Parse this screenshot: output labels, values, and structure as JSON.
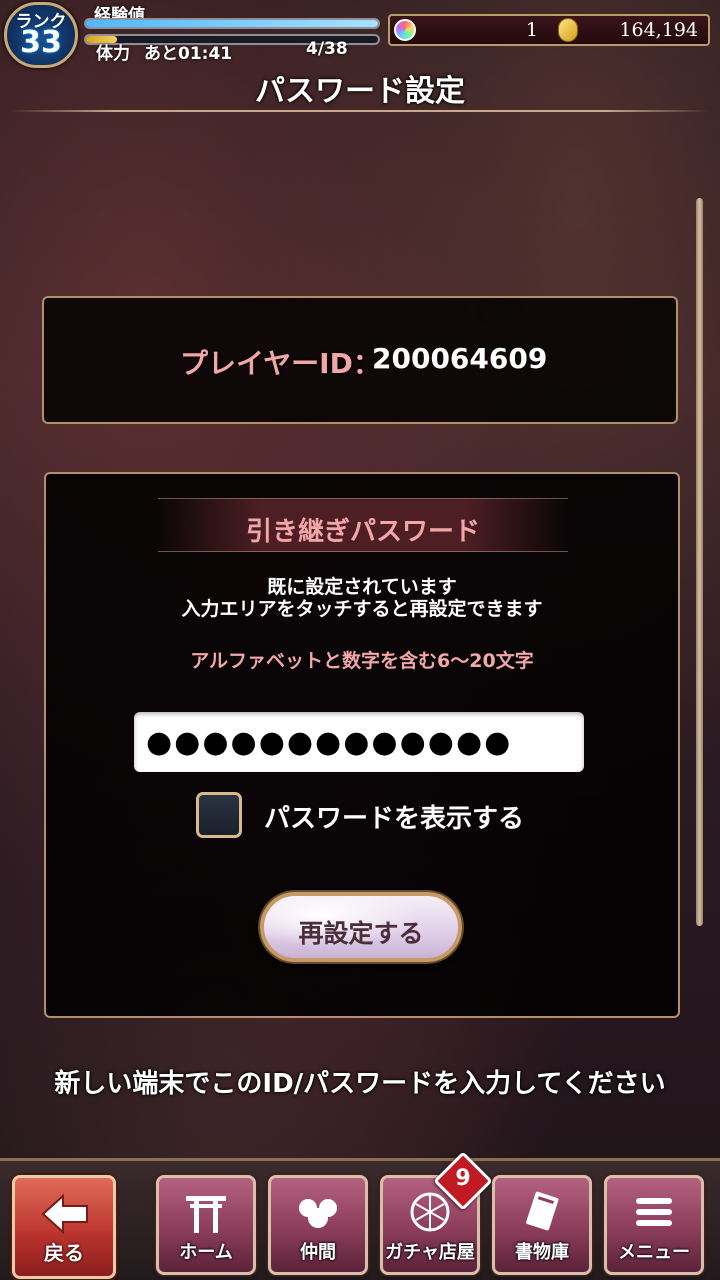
{
  "status": {
    "rank_label": "ランク",
    "rank_value": "33",
    "exp_label": "経験値",
    "exp_progress": 1.0,
    "stamina_label": "体力",
    "stamina_time": "あと01:41",
    "stamina_count": "4/38",
    "stamina_progress": 0.105,
    "gem_count": "1",
    "coin_count": "164,194"
  },
  "page": {
    "title": "パスワード設定"
  },
  "player": {
    "id_label": "プレイヤーID：",
    "id_value": "200064609"
  },
  "password_section": {
    "title": "引き継ぎパスワード",
    "status_line1": "既に設定されています",
    "status_line2": "入力エリアをタッチすると再設定できます",
    "rule": "アルファベットと数字を含む6〜20文字",
    "password_value": "●●●●●●●●●●●●●",
    "show_password_label": "パスワードを表示する",
    "show_password_checked": false,
    "reset_button": "再設定する"
  },
  "note": "新しい端末でこのID/パスワードを入力してください",
  "nav": {
    "back": "戻る",
    "items": [
      {
        "label": "ホーム",
        "icon": "torii-icon"
      },
      {
        "label": "仲間",
        "icon": "companions-icon"
      },
      {
        "label": "ガチャ店屋",
        "icon": "gacha-icon",
        "badge": "9"
      },
      {
        "label": "書物庫",
        "icon": "book-icon"
      },
      {
        "label": "メニュー",
        "icon": "menu-icon"
      }
    ]
  },
  "colors": {
    "accent_pink": "#f1a6a8",
    "panel_border": "#b58e6a",
    "badge_red": "#c21a24"
  }
}
